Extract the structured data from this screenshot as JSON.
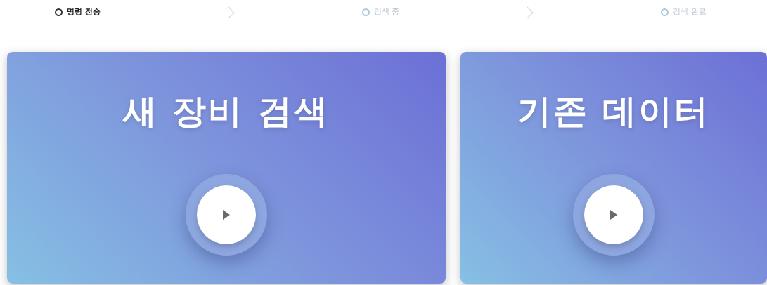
{
  "steps": [
    {
      "label": "명령 전송",
      "selected": true
    },
    {
      "label": "검색 중",
      "selected": false
    },
    {
      "label": "검색 완료",
      "selected": false
    }
  ],
  "cards": [
    {
      "title": "새 장비 검색"
    },
    {
      "title": "기존 데이터"
    }
  ]
}
